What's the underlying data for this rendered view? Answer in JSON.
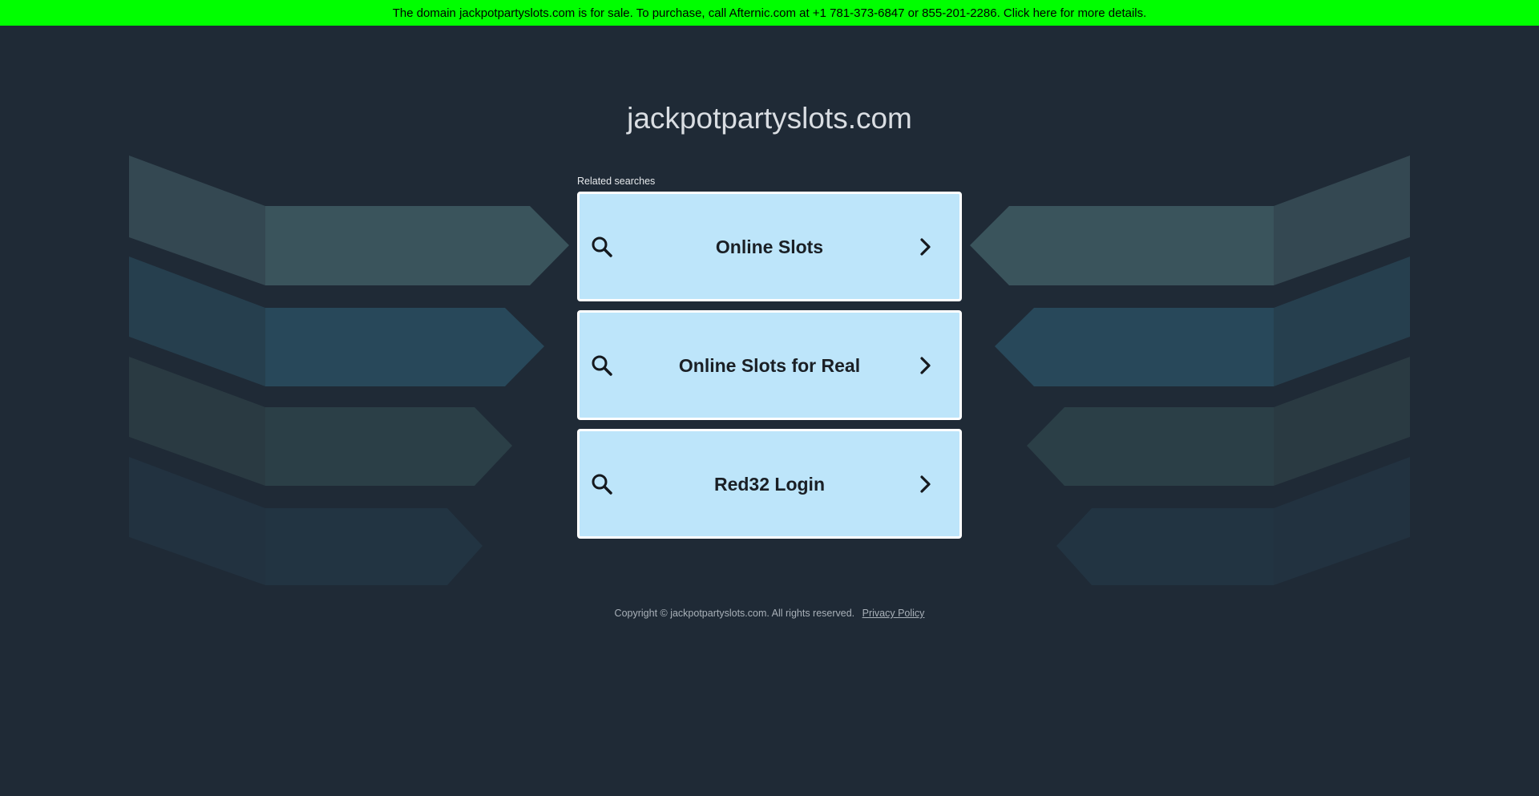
{
  "banner": {
    "text": "The domain jackpotpartyslots.com is for sale. To purchase, call Afternic.com at +1 781-373-6847 or 855-201-2286. Click here for more details."
  },
  "site": {
    "title": "jackpotpartyslots.com"
  },
  "related": {
    "label": "Related searches",
    "items": [
      {
        "label": "Online Slots"
      },
      {
        "label": "Online Slots for Real"
      },
      {
        "label": "Red32 Login"
      }
    ]
  },
  "footer": {
    "copyright": "Copyright © jackpotpartyslots.com.  All rights reserved.",
    "privacy_label": "Privacy Policy"
  },
  "colors": {
    "banner_bg": "#00ff00",
    "page_bg": "#1f2a36",
    "card_bg": "#bde5fa",
    "card_border": "#ffffff"
  },
  "icons": {
    "search": "search-icon",
    "chevron": "chevron-right-icon"
  }
}
